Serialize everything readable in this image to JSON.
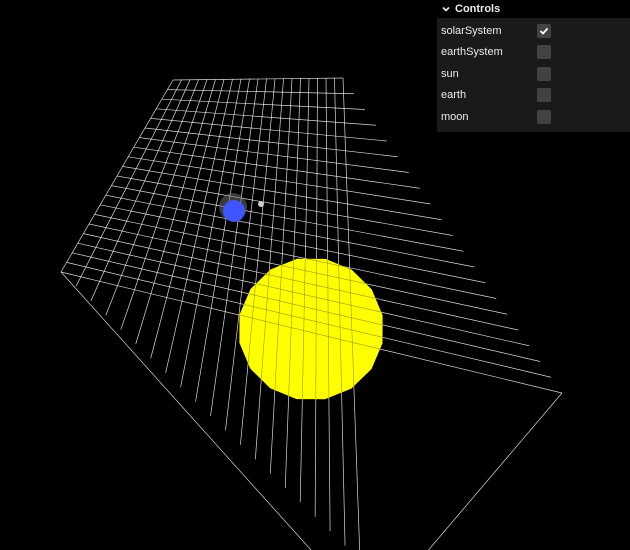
{
  "scene": {
    "background_color": "#000000",
    "grid_color": "#ffffff",
    "sun_color": "#ffff00",
    "earth_color": "#3f55ff",
    "moon_color": "#cccccc"
  },
  "controls": {
    "title": "Controls",
    "items": [
      {
        "label": "solarSystem",
        "checked": true
      },
      {
        "label": "earthSystem",
        "checked": false
      },
      {
        "label": "sun",
        "checked": false
      },
      {
        "label": "earth",
        "checked": false
      },
      {
        "label": "moon",
        "checked": false
      }
    ]
  }
}
